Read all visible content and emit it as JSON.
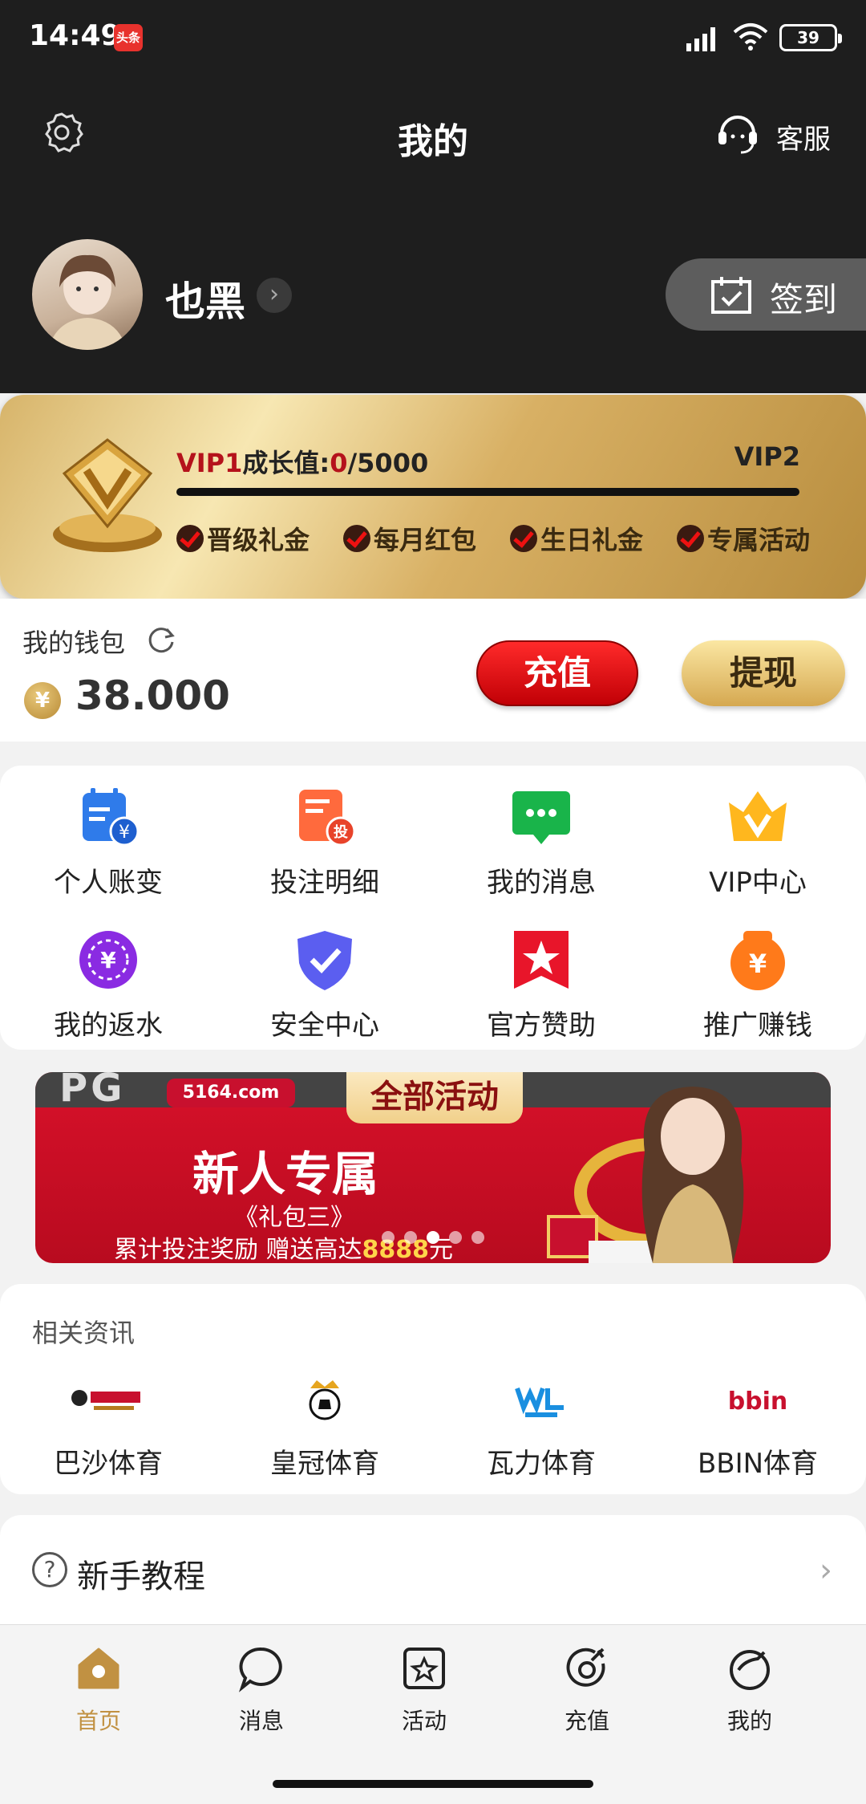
{
  "status_bar": {
    "time": "14:49",
    "app_badge": "头条",
    "battery": "39"
  },
  "header": {
    "title": "我的",
    "service_label": "客服"
  },
  "user": {
    "name": "也黑",
    "signin_label": "签到"
  },
  "vip": {
    "current": "VIP1",
    "growth_label": "成长值:",
    "growth_value": "0",
    "growth_max": "/5000",
    "next_level": "VIP2",
    "progress": 0,
    "perks": [
      "晋级礼金",
      "每月红包",
      "生日礼金",
      "专属活动"
    ]
  },
  "wallet": {
    "title": "我的钱包",
    "currency_symbol": "¥",
    "amount": "38.000",
    "recharge_label": "充值",
    "withdraw_label": "提现"
  },
  "grid": [
    {
      "label": "个人账变",
      "icon": "account-change-icon"
    },
    {
      "label": "投注明细",
      "icon": "bet-detail-icon"
    },
    {
      "label": "我的消息",
      "icon": "message-icon"
    },
    {
      "label": "VIP中心",
      "icon": "vip-crown-icon"
    },
    {
      "label": "我的返水",
      "icon": "rebate-icon"
    },
    {
      "label": "安全中心",
      "icon": "shield-icon"
    },
    {
      "label": "官方赞助",
      "icon": "sponsor-star-icon"
    },
    {
      "label": "推广赚钱",
      "icon": "promote-money-icon"
    }
  ],
  "banner": {
    "site": "5164.com",
    "tab": "全部活动",
    "headline": "新人专属",
    "subtitle": "《礼包三》",
    "desc_prefix": "累计投注奖励 赠送高达",
    "desc_highlight": "8888",
    "desc_suffix": "元",
    "slide_count": 5,
    "active_slide": 2
  },
  "news": {
    "title": "相关资讯",
    "items": [
      {
        "label": "巴沙体育",
        "icon": "basha-logo"
      },
      {
        "label": "皇冠体育",
        "icon": "crown-logo"
      },
      {
        "label": "瓦力体育",
        "icon": "wali-logo"
      },
      {
        "label": "BBIN体育",
        "icon": "bbin-logo",
        "logo_text": "bbin"
      }
    ]
  },
  "tutorial": {
    "label": "新手教程"
  },
  "tabbar": [
    {
      "label": "首页",
      "icon": "home-icon",
      "active": true
    },
    {
      "label": "消息",
      "icon": "chat-icon",
      "active": false
    },
    {
      "label": "活动",
      "icon": "activity-icon",
      "active": false
    },
    {
      "label": "充值",
      "icon": "recharge-icon",
      "active": false
    },
    {
      "label": "我的",
      "icon": "profile-icon",
      "active": false
    }
  ],
  "colors": {
    "accent_gold": "#c19142",
    "red": "#c10006",
    "dark": "#1e1e1e"
  }
}
